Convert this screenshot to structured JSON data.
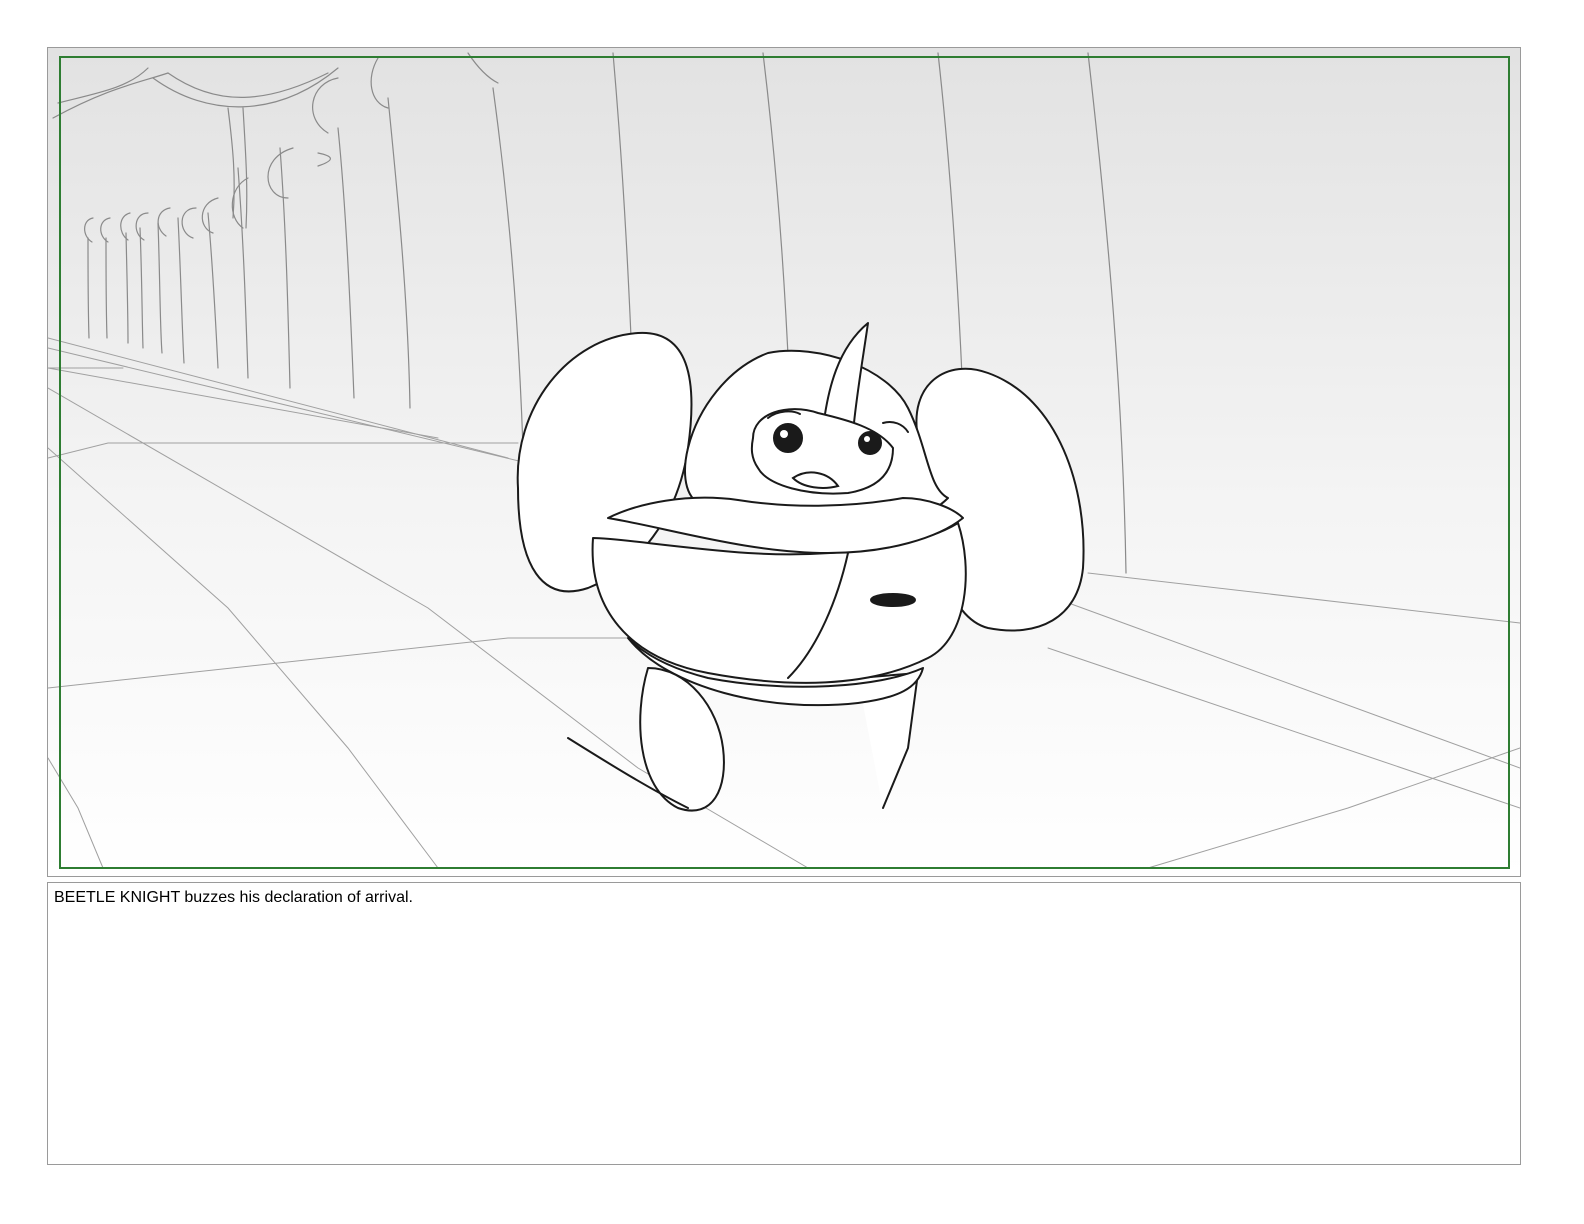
{
  "panel": {
    "image": "storyboard-sketch-beetle-knight-palace-hallway",
    "colors": {
      "safe_area_border": "#2e7d32",
      "frame_border": "#9a9a9a",
      "sky_top": "#e2e2e2",
      "sky_bottom": "#ffffff"
    }
  },
  "notes": {
    "action": "BEETLE KNIGHT buzzes his declaration of arrival."
  }
}
